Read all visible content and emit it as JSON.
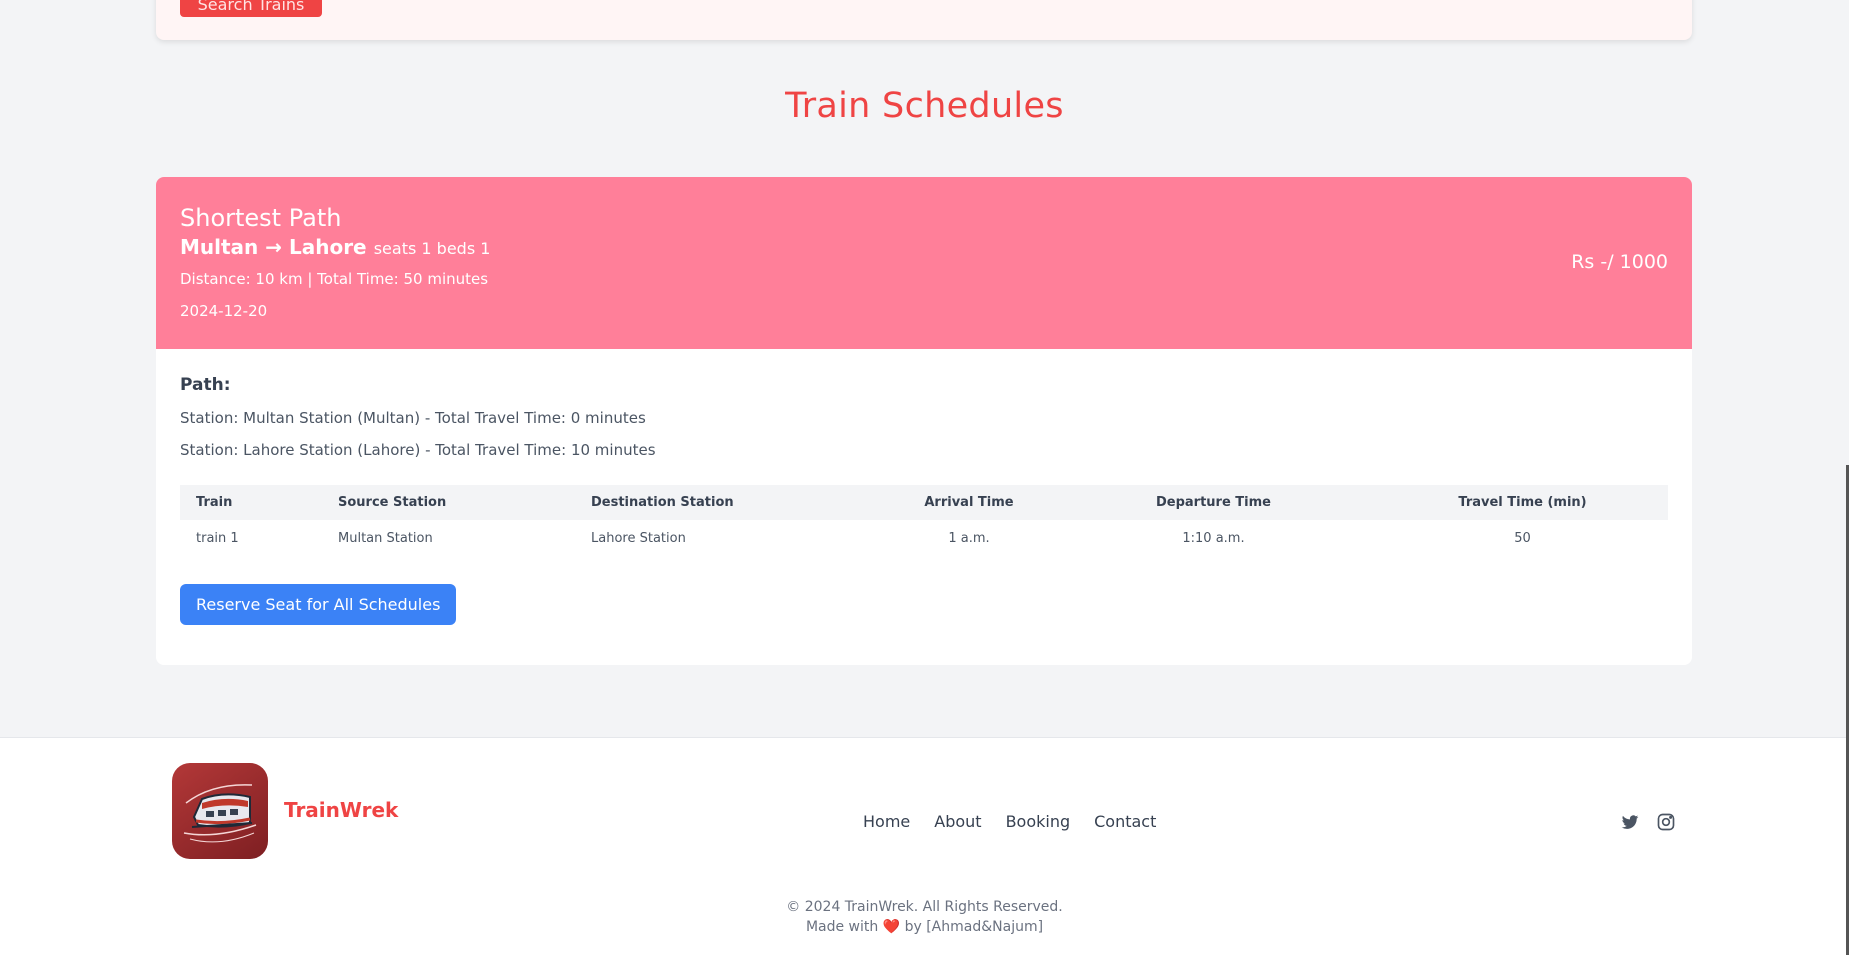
{
  "search": {
    "button_label": "Search Trains"
  },
  "section_title": "Train Schedules",
  "schedule": {
    "title": "Shortest Path",
    "route": "Multan → Lahore",
    "seats_beds": "seats 1 beds 1",
    "summary": "Distance: 10 km | Total Time: 50 minutes",
    "date": "2024-12-20",
    "price": "Rs -/ 1000",
    "path_label": "Path:",
    "path_steps": [
      "Station: Multan Station (Multan) - Total Travel Time: 0 minutes",
      "Station: Lahore Station (Lahore) - Total Travel Time: 10 minutes"
    ],
    "table": {
      "headers": [
        "Train",
        "Source Station",
        "Destination Station",
        "Arrival Time",
        "Departure Time",
        "Travel Time (min)"
      ],
      "rows": [
        [
          "train 1",
          "Multan Station",
          "Lahore Station",
          "1 a.m.",
          "1:10 a.m.",
          "50"
        ]
      ]
    },
    "reserve_label": "Reserve Seat for All Schedules"
  },
  "footer": {
    "brand": "TrainWrek",
    "nav": [
      "Home",
      "About",
      "Booking",
      "Contact"
    ],
    "copyright": "© 2024 TrainWrek. All Rights Reserved.",
    "made_with_prefix": "Made with",
    "made_with_heart": "❤️",
    "made_with_suffix": "by [Ahmad&Najum]",
    "icons": [
      "twitter-icon",
      "instagram-icon"
    ]
  },
  "colors": {
    "accent": "#ef4444",
    "header_pink": "#ff7f99",
    "button_blue": "#3b82f6"
  }
}
